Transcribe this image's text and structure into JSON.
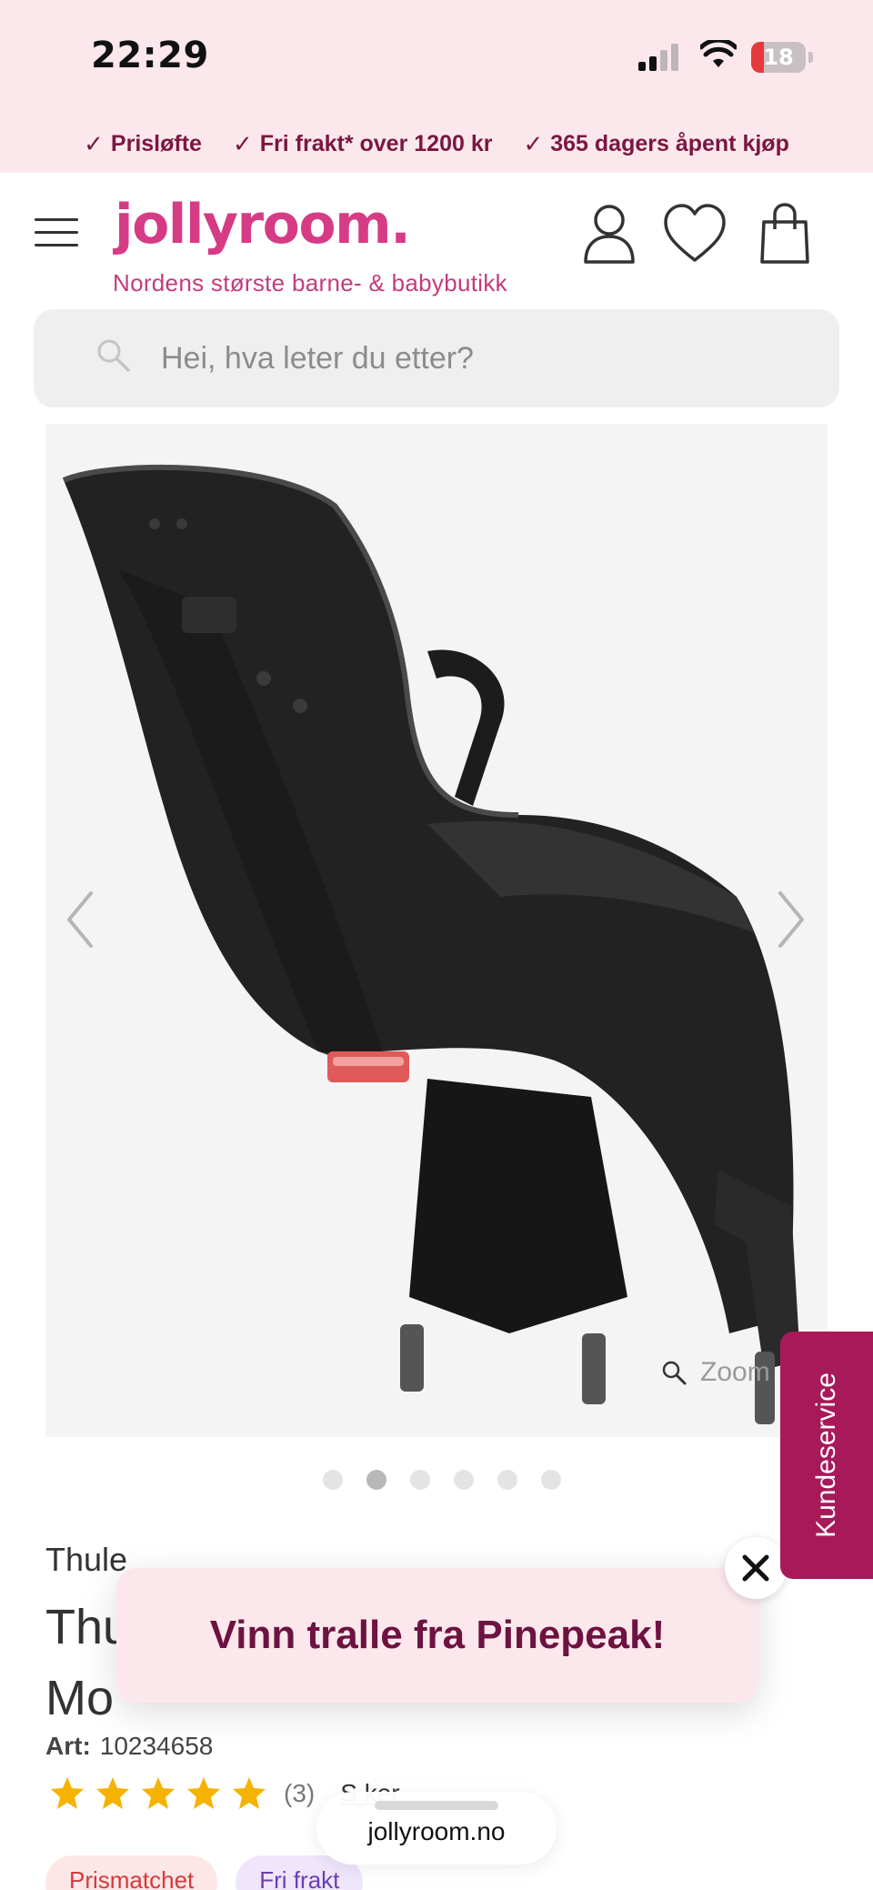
{
  "status_bar": {
    "time": "22:29",
    "battery": "18"
  },
  "usp": [
    {
      "label": "Prisløfte"
    },
    {
      "label": "Fri frakt* over 1200 kr"
    },
    {
      "label": "365 dagers åpent kjøp"
    }
  ],
  "header": {
    "logo": "jollyroom.",
    "tagline": "Nordens største barne- & babybutikk"
  },
  "search": {
    "placeholder": "Hei, hva leter du etter?"
  },
  "gallery": {
    "zoom_label": "Zoom",
    "image_count": 6,
    "active_index": 1
  },
  "product": {
    "brand": "Thule",
    "title_line1": "Thu",
    "title_line2": "Mo",
    "art_label": "Art:",
    "art_number": "10234658",
    "rating": 5,
    "rating_count": "(3)",
    "reviews_link": "S          ker"
  },
  "badges": [
    {
      "label": "Prismatchet"
    },
    {
      "label": "Fri frakt"
    }
  ],
  "promo": {
    "text": "Vinn tralle fra Pinepeak!"
  },
  "side_tab": {
    "label": "Kundeservice"
  },
  "browser": {
    "url": "jollyroom.no"
  },
  "colors": {
    "brand_pink": "#d63b86",
    "usp_text": "#7a1741",
    "side_tab": "#a8195a",
    "promo_bg": "#fce8ec",
    "star": "#f5b301"
  }
}
